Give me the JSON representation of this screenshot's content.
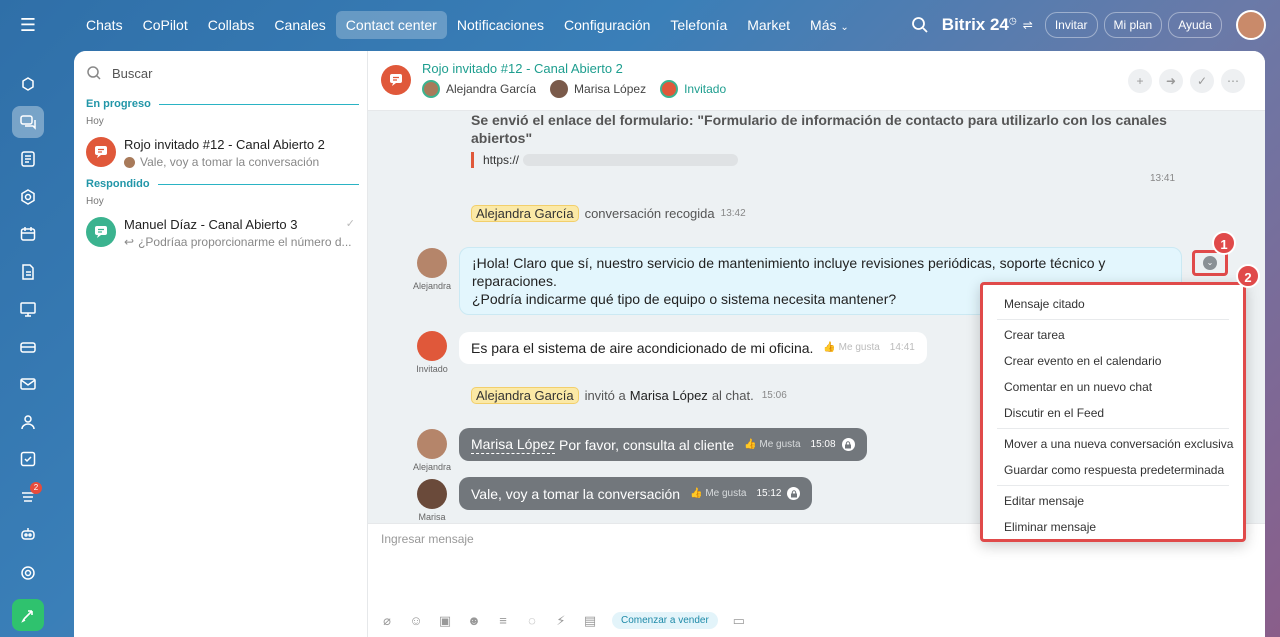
{
  "nav": {
    "items": [
      "Chats",
      "CoPilot",
      "Collabs",
      "Canales",
      "Contact center",
      "Notificaciones",
      "Configuración",
      "Telefonía",
      "Market",
      "Más"
    ],
    "active": "Contact center"
  },
  "top": {
    "brand": "Bitrix 24",
    "invite": "Invitar",
    "plan": "Mi plan",
    "help": "Ayuda"
  },
  "rail": {
    "badge": "2"
  },
  "list": {
    "search_placeholder": "Buscar",
    "section_progress": "En progreso",
    "section_answered": "Respondido",
    "today": "Hoy",
    "items": [
      {
        "title": "Rojo invitado #12 - Canal Abierto 2",
        "preview": "Vale, voy a tomar la conversación"
      },
      {
        "title": "Manuel Díaz - Canal Abierto 3",
        "preview": "¿Podríaa proporcionarme el número d..."
      }
    ]
  },
  "chat": {
    "title": "Rojo invitado #12 - Canal Abierto 2",
    "members": [
      "Alejandra García",
      "Marisa López",
      "Invitado"
    ],
    "form_text": "Se envió el enlace del formulario: \"Formulario de información de contacto para utilizarlo con los canales abiertos\"",
    "form_link": "https://",
    "form_time": "13:41",
    "sys1": {
      "name": "Alejandra García",
      "text": "conversación recogida",
      "time": "13:42"
    },
    "msg1": {
      "author": "Alejandra",
      "line1": "¡Hola! Claro que sí, nuestro servicio de mantenimiento incluye revisiones periódicas, soporte técnico y reparaciones.",
      "line2": "¿Podría indicarme qué tipo de equipo o sistema necesita mantener?"
    },
    "msg2": {
      "author": "Invitado",
      "text": "Es para el sistema de aire acondicionado de mi oficina.",
      "like": "Me gusta",
      "time": "14:41"
    },
    "sys2": {
      "name": "Alejandra García",
      "invited": "invitó a",
      "name2": "Marisa López",
      "text": "al chat.",
      "time": "15:06"
    },
    "msg3": {
      "author": "Alejandra",
      "mention": "Marisa López",
      "text": "Por favor, consulta al cliente",
      "like": "Me gusta",
      "time": "15:08"
    },
    "msg4": {
      "author": "Marisa",
      "text": "Vale, voy a tomar la conversación",
      "like": "Me gusta",
      "time": "15:12"
    }
  },
  "compose": {
    "placeholder": "Ingresar mensaje",
    "sell": "Comenzar a vender"
  },
  "menu": {
    "items": [
      "Mensaje citado",
      "Crear tarea",
      "Crear evento en el calendario",
      "Comentar en un nuevo chat",
      "Discutir en el Feed",
      "Mover a una nueva conversación exclusiva",
      "Guardar como respuesta predeterminada",
      "Editar mensaje",
      "Eliminar mensaje"
    ]
  },
  "steps": [
    "1",
    "2"
  ],
  "colors": {
    "accent": "#1e9e8f",
    "highlight": "#e04a4a",
    "openline": "#e0583a"
  }
}
